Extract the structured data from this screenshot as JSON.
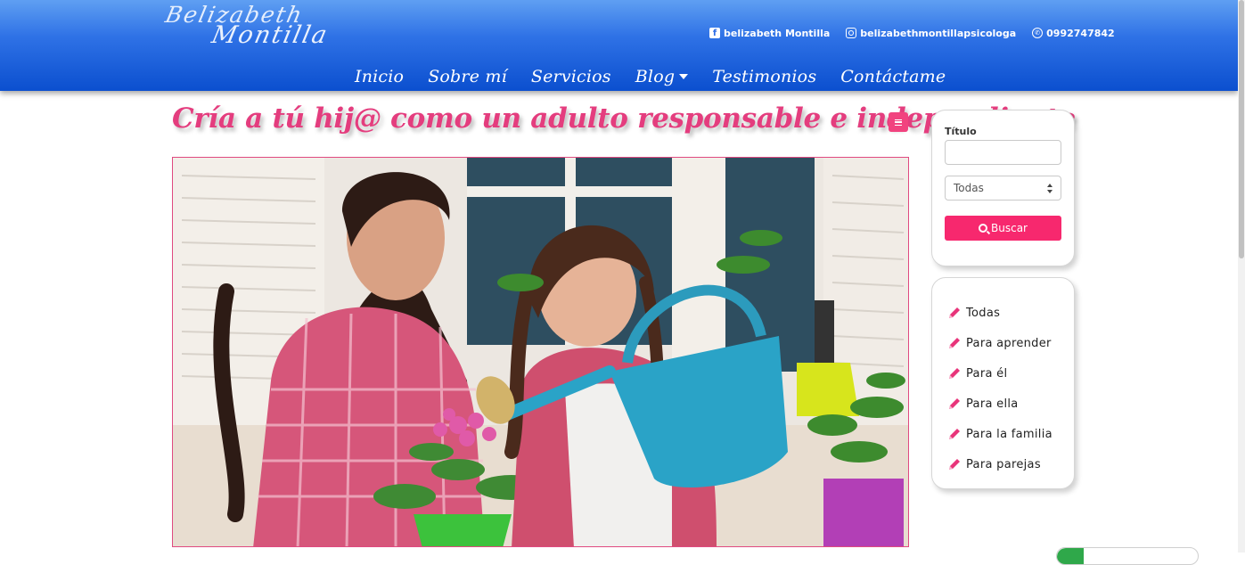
{
  "header": {
    "logo": {
      "line1": "Belizabeth",
      "line2": "Montilla"
    },
    "social": [
      {
        "icon": "facebook-icon",
        "label": "belizabeth Montilla"
      },
      {
        "icon": "instagram-icon",
        "label": "belizabethmontillapsicologa"
      },
      {
        "icon": "whatsapp-icon",
        "label": "0992747842"
      }
    ],
    "nav": [
      {
        "label": "Inicio"
      },
      {
        "label": "Sobre mí"
      },
      {
        "label": "Servicios"
      },
      {
        "label": "Blog",
        "has_dropdown": true
      },
      {
        "label": "Testimonios"
      },
      {
        "label": "Contáctame"
      }
    ]
  },
  "post": {
    "title": "Cría a tú hij@ como un adulto responsable e independiente",
    "image_icon": "photo-mother-daughter-watering-plants"
  },
  "sidebar": {
    "search": {
      "title_label": "Título",
      "title_value": "",
      "category_selected": "Todas",
      "button_label": "Buscar"
    },
    "categories": [
      {
        "label": "Todas"
      },
      {
        "label": "Para aprender"
      },
      {
        "label": "Para él"
      },
      {
        "label": "Para ella"
      },
      {
        "label": "Para la familia"
      },
      {
        "label": "Para parejas"
      }
    ]
  },
  "colors": {
    "header_top": "#5f9ff2",
    "header_bottom": "#0b4fcf",
    "title_pink": "#e43d7e",
    "button_pink": "#f7286e",
    "pencil_pink": "#e8347a"
  }
}
